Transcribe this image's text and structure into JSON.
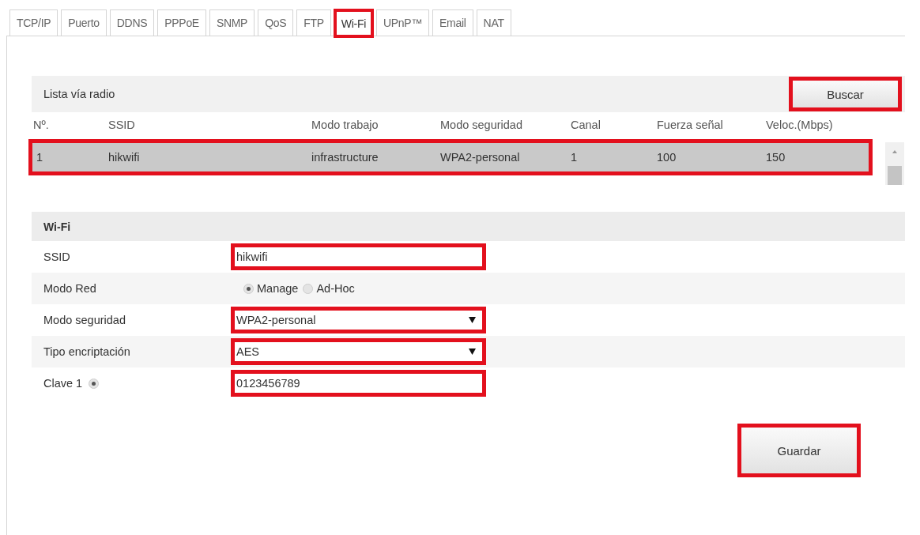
{
  "tabs": [
    {
      "label": "TCP/IP",
      "selected": false,
      "highlighted": false
    },
    {
      "label": "Puerto",
      "selected": false,
      "highlighted": false
    },
    {
      "label": "DDNS",
      "selected": false,
      "highlighted": false
    },
    {
      "label": "PPPoE",
      "selected": false,
      "highlighted": false
    },
    {
      "label": "SNMP",
      "selected": false,
      "highlighted": false
    },
    {
      "label": "QoS",
      "selected": false,
      "highlighted": false
    },
    {
      "label": "FTP",
      "selected": false,
      "highlighted": false
    },
    {
      "label": "Wi-Fi",
      "selected": true,
      "highlighted": true
    },
    {
      "label": "UPnP™",
      "selected": false,
      "highlighted": false
    },
    {
      "label": "Email",
      "selected": false,
      "highlighted": false
    },
    {
      "label": "NAT",
      "selected": false,
      "highlighted": false
    }
  ],
  "radio_list": {
    "title": "Lista vía radio",
    "search_button": {
      "label": "Buscar",
      "highlighted": true
    },
    "columns": [
      "Nº.",
      "SSID",
      "Modo trabajo",
      "Modo seguridad",
      "Canal",
      "Fuerza señal",
      "Veloc.(Mbps)"
    ],
    "rows": [
      {
        "cells": [
          "1",
          "hikwifi",
          "infrastructure",
          "WPA2-personal",
          "1",
          "100",
          "150"
        ],
        "selected": true,
        "highlighted": true
      }
    ]
  },
  "wifi": {
    "title": "Wi-Fi",
    "fields": [
      {
        "kind": "text",
        "label": "SSID",
        "value": "hikwifi",
        "highlighted": true
      },
      {
        "kind": "radio",
        "label": "Modo Red",
        "options": [
          {
            "label": "Manage",
            "selected": true
          },
          {
            "label": "Ad-Hoc",
            "selected": false
          }
        ]
      },
      {
        "kind": "select",
        "label": "Modo seguridad",
        "value": "WPA2-personal",
        "highlighted": true
      },
      {
        "kind": "select",
        "label": "Tipo encriptación",
        "value": "AES",
        "highlighted": true
      },
      {
        "kind": "key",
        "label": "Clave 1",
        "selected": true,
        "value": "0123456789",
        "highlighted": true
      }
    ]
  },
  "save_button": {
    "label": "Guardar",
    "highlighted": true
  }
}
